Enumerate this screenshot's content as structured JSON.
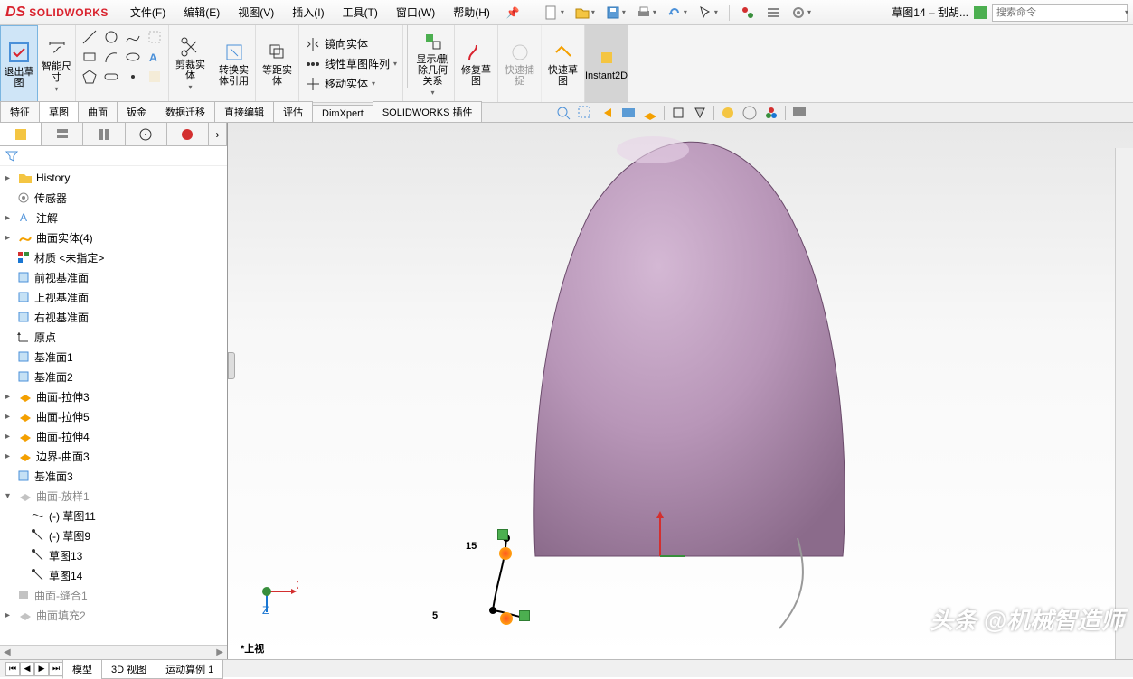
{
  "app": {
    "brand_prefix": "DS",
    "brand": "SOLIDWORKS",
    "doc_title": "草图14 – 刮胡...",
    "search_placeholder": "搜索命令"
  },
  "menu": {
    "file": "文件(F)",
    "edit": "编辑(E)",
    "view": "视图(V)",
    "insert": "插入(I)",
    "tools": "工具(T)",
    "window": "窗口(W)",
    "help": "帮助(H)"
  },
  "cmd": {
    "exit_sketch": "退出草图",
    "smart_dim": "智能尺寸",
    "trim": "剪裁实体",
    "convert": "转换实体引用",
    "offset": "等距实体",
    "mirror": "镜向实体",
    "linear_pattern": "线性草图阵列",
    "move": "移动实体",
    "show_del": "显示/删除几何关系",
    "repair": "修复草图",
    "quick_snap": "快速捕捉",
    "rapid": "快速草图",
    "instant": "Instant2D"
  },
  "cm_tabs": {
    "feature": "特征",
    "sketch": "草图",
    "surface": "曲面",
    "sheetmetal": "钣金",
    "migration": "数据迁移",
    "direct": "直接编辑",
    "evaluate": "评估",
    "dimxpert": "DimXpert",
    "addins": "SOLIDWORKS 插件"
  },
  "tree": {
    "history": "History",
    "sensors": "传感器",
    "annotations": "注解",
    "surf_bodies": "曲面实体(4)",
    "material": "材质 <未指定>",
    "front": "前视基准面",
    "top": "上视基准面",
    "right": "右视基准面",
    "origin": "原点",
    "plane1": "基准面1",
    "plane2": "基准面2",
    "extr3": "曲面-拉伸3",
    "extr5": "曲面-拉伸5",
    "extr4": "曲面-拉伸4",
    "boundary3": "边界-曲面3",
    "plane3": "基准面3",
    "loft1": "曲面-放样1",
    "sk11": "(-) 草图11",
    "sk9": "(-) 草图9",
    "sk13": "草图13",
    "sk14": "草图14",
    "knit1": "曲面-缝合1",
    "fill2": "曲面填充2"
  },
  "viewport": {
    "dim15": "15",
    "dim5": "5",
    "view_label": "*上视"
  },
  "bottom": {
    "model": "模型",
    "threeD": "3D 视图",
    "motion": "运动算例 1"
  },
  "watermark": "头条 @机械智造师"
}
